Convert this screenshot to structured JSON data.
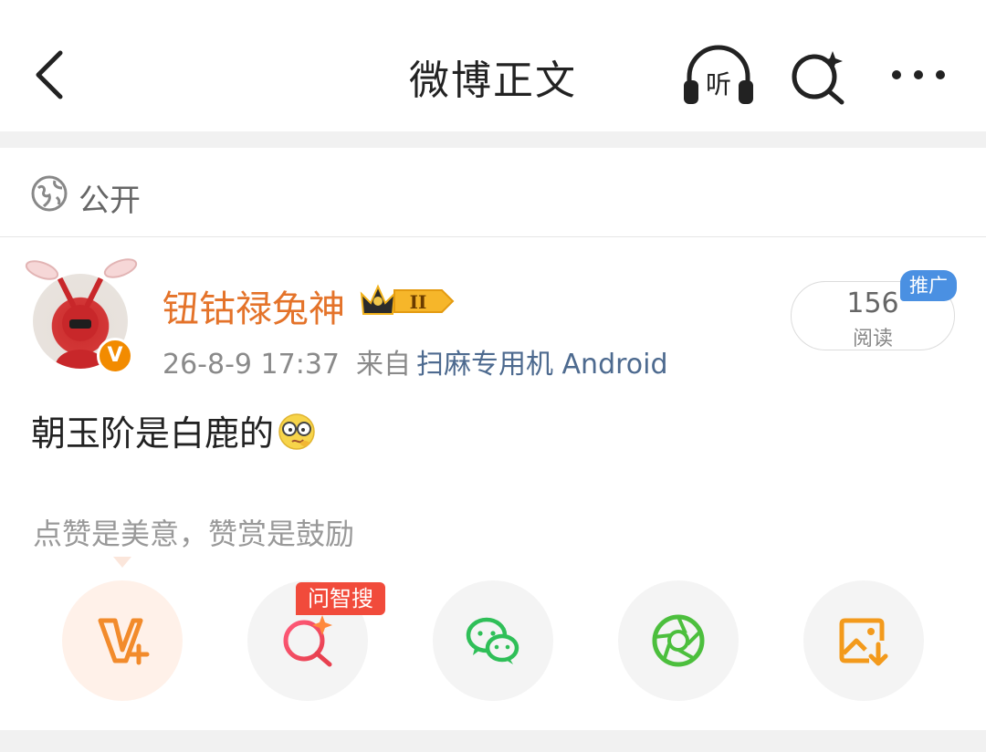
{
  "header": {
    "title": "微博正文",
    "listen_label": "听"
  },
  "visibility": {
    "label": "公开"
  },
  "post": {
    "author": "钮钴禄兔神",
    "level_badge": "II",
    "timestamp": "26-8-9 17:37",
    "from_label": "来自",
    "device": "扫麻专用机 Android",
    "content": "朝玉阶是白鹿的",
    "emoji": "glasses-face-emoji",
    "read_count": "156",
    "read_label": "阅读",
    "promo_tag": "推广"
  },
  "share": {
    "tip": "点赞是美意，赞赏是鼓励",
    "badge": "问智搜",
    "items": [
      {
        "name": "v-plus-icon",
        "color": "#f28b2c"
      },
      {
        "name": "ai-search-icon",
        "color": "#e8404f"
      },
      {
        "name": "wechat-icon",
        "color": "#2fbf58"
      },
      {
        "name": "moments-icon",
        "color": "#4cbf3d"
      },
      {
        "name": "save-image-icon",
        "color": "#f39a1c"
      }
    ]
  },
  "colors": {
    "author": "#e4732a",
    "device_link": "#4d6a8f",
    "promo": "#4a90e2",
    "badge_red": "#f14b3b"
  }
}
